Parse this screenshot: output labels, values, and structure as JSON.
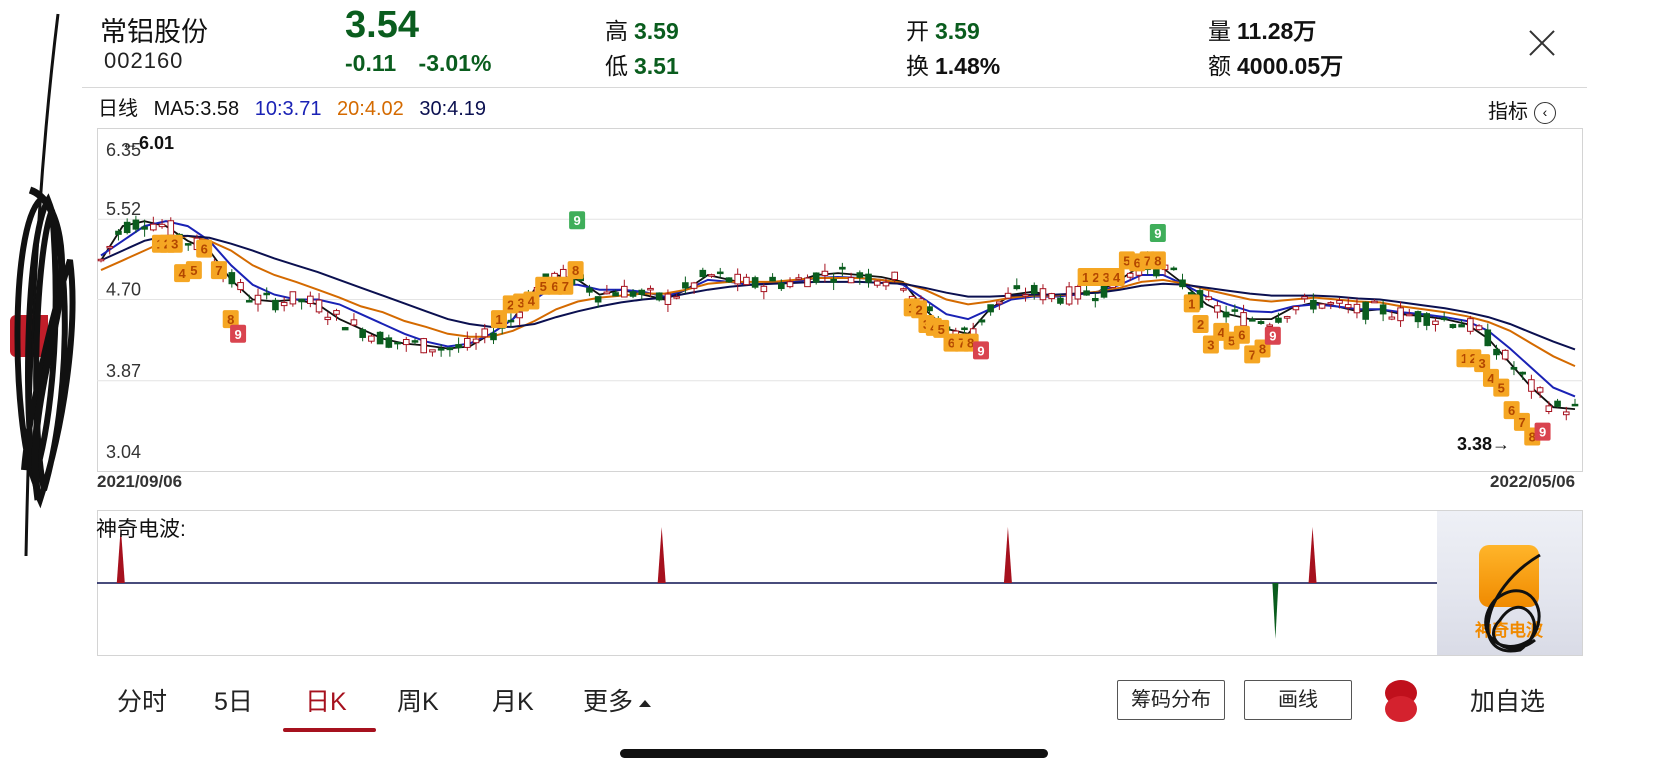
{
  "header": {
    "stock_name": "常铝股份",
    "stock_code": "002160",
    "price": "3.54",
    "change": "-0.11",
    "change_pct": "-3.01%",
    "high_label": "高",
    "high_value": "3.59",
    "low_label": "低",
    "low_value": "3.51",
    "open_label": "开",
    "open_value": "3.59",
    "turnover_label": "换",
    "turnover_value": "1.48%",
    "volume_label": "量",
    "volume_value": "11.28万",
    "amount_label": "额",
    "amount_value": "4000.05万"
  },
  "ma_legend": {
    "period": "日线",
    "ma5": "MA5:3.58",
    "ma10": "10:3.71",
    "ma20": "20:4.02",
    "ma30": "30:4.19"
  },
  "indicator_button": "指标",
  "colors": {
    "up": "#a6111e",
    "down": "#0a5d1e",
    "ma5": "#111111",
    "ma10": "#1a22b5",
    "ma20": "#d46a00",
    "ma30": "#0b1050",
    "signal_orange": "#f5a623",
    "signal_red": "#d9444f",
    "signal_green": "#3fae5a"
  },
  "chart_data": {
    "type": "candlestick",
    "y_ticks": [
      "6.35",
      "5.52",
      "4.70",
      "3.87",
      "3.04"
    ],
    "ylim": [
      3.04,
      6.35
    ],
    "x_start_label": "2021/09/06",
    "x_end_label": "2022/05/06",
    "max_marker": "←6.01",
    "min_marker": "3.38→",
    "series": [
      {
        "name": "MA5",
        "values": [
          5.1,
          5.45,
          5.5,
          5.45,
          5.3,
          5.2,
          4.9,
          4.7,
          4.68,
          4.7,
          4.65,
          4.5,
          4.4,
          4.3,
          4.25,
          4.23,
          4.2,
          4.22,
          4.35,
          4.5,
          4.8,
          4.95,
          4.9,
          4.75,
          4.8,
          4.75,
          4.7,
          4.8,
          4.95,
          4.9,
          4.85,
          4.87,
          4.88,
          4.95,
          4.97,
          4.95,
          4.93,
          4.88,
          4.6,
          4.4,
          4.35,
          4.6,
          4.75,
          4.78,
          4.73,
          4.75,
          4.78,
          4.9,
          5.05,
          5.02,
          4.85,
          4.65,
          4.55,
          4.5,
          4.5,
          4.62,
          4.67,
          4.63,
          4.58,
          4.6,
          4.55,
          4.53,
          4.5,
          4.45,
          4.3,
          4.05,
          3.8,
          3.6,
          3.58
        ]
      },
      {
        "name": "MA10",
        "values": [
          5.15,
          5.3,
          5.45,
          5.5,
          5.45,
          5.3,
          5.05,
          4.85,
          4.75,
          4.7,
          4.7,
          4.65,
          4.55,
          4.45,
          4.35,
          4.27,
          4.22,
          4.25,
          4.35,
          4.5,
          4.7,
          4.85,
          4.85,
          4.8,
          4.8,
          4.78,
          4.73,
          4.8,
          4.9,
          4.88,
          4.85,
          4.87,
          4.88,
          4.92,
          4.93,
          4.92,
          4.9,
          4.85,
          4.7,
          4.55,
          4.5,
          4.6,
          4.7,
          4.73,
          4.73,
          4.75,
          4.78,
          4.85,
          4.95,
          4.95,
          4.85,
          4.73,
          4.65,
          4.58,
          4.57,
          4.63,
          4.65,
          4.63,
          4.6,
          4.6,
          4.57,
          4.55,
          4.52,
          4.48,
          4.38,
          4.2,
          4.0,
          3.8,
          3.71
        ]
      },
      {
        "name": "MA20",
        "values": [
          5.0,
          5.1,
          5.2,
          5.3,
          5.35,
          5.3,
          5.2,
          5.05,
          4.95,
          4.88,
          4.8,
          4.72,
          4.63,
          4.57,
          4.48,
          4.42,
          4.35,
          4.32,
          4.32,
          4.38,
          4.48,
          4.6,
          4.68,
          4.72,
          4.74,
          4.76,
          4.76,
          4.8,
          4.86,
          4.88,
          4.88,
          4.88,
          4.9,
          4.92,
          4.92,
          4.92,
          4.9,
          4.87,
          4.8,
          4.7,
          4.65,
          4.68,
          4.72,
          4.74,
          4.74,
          4.76,
          4.78,
          4.82,
          4.88,
          4.9,
          4.86,
          4.8,
          4.75,
          4.7,
          4.68,
          4.7,
          4.72,
          4.7,
          4.68,
          4.67,
          4.63,
          4.6,
          4.57,
          4.53,
          4.47,
          4.38,
          4.25,
          4.12,
          4.02
        ]
      },
      {
        "name": "MA30",
        "values": [
          5.1,
          5.2,
          5.3,
          5.35,
          5.35,
          5.33,
          5.27,
          5.2,
          5.12,
          5.05,
          4.98,
          4.9,
          4.82,
          4.74,
          4.66,
          4.58,
          4.5,
          4.45,
          4.42,
          4.42,
          4.45,
          4.52,
          4.58,
          4.63,
          4.67,
          4.7,
          4.72,
          4.76,
          4.8,
          4.83,
          4.85,
          4.86,
          4.87,
          4.88,
          4.88,
          4.88,
          4.87,
          4.86,
          4.82,
          4.77,
          4.73,
          4.73,
          4.74,
          4.75,
          4.75,
          4.76,
          4.77,
          4.8,
          4.84,
          4.86,
          4.85,
          4.82,
          4.79,
          4.76,
          4.74,
          4.74,
          4.74,
          4.73,
          4.71,
          4.7,
          4.67,
          4.64,
          4.61,
          4.57,
          4.52,
          4.45,
          4.36,
          4.27,
          4.19
        ]
      }
    ],
    "signals": [
      {
        "x": 0.04,
        "price": 5.27,
        "label": "1",
        "kind": "orange"
      },
      {
        "x": 0.045,
        "price": 5.27,
        "label": "2",
        "kind": "orange"
      },
      {
        "x": 0.05,
        "price": 5.27,
        "label": "3",
        "kind": "orange"
      },
      {
        "x": 0.055,
        "price": 4.97,
        "label": "4",
        "kind": "orange"
      },
      {
        "x": 0.063,
        "price": 5.0,
        "label": "5",
        "kind": "orange"
      },
      {
        "x": 0.07,
        "price": 5.22,
        "label": "6",
        "kind": "orange"
      },
      {
        "x": 0.08,
        "price": 5.0,
        "label": "7",
        "kind": "orange"
      },
      {
        "x": 0.088,
        "price": 4.5,
        "label": "8",
        "kind": "orange"
      },
      {
        "x": 0.093,
        "price": 4.35,
        "label": "9",
        "kind": "red"
      },
      {
        "x": 0.27,
        "price": 4.5,
        "label": "1",
        "kind": "orange"
      },
      {
        "x": 0.278,
        "price": 4.65,
        "label": "2",
        "kind": "orange"
      },
      {
        "x": 0.285,
        "price": 4.67,
        "label": "3",
        "kind": "orange"
      },
      {
        "x": 0.292,
        "price": 4.69,
        "label": "4",
        "kind": "orange"
      },
      {
        "x": 0.3,
        "price": 4.84,
        "label": "5",
        "kind": "orange"
      },
      {
        "x": 0.308,
        "price": 4.84,
        "label": "6",
        "kind": "orange"
      },
      {
        "x": 0.315,
        "price": 4.84,
        "label": "7",
        "kind": "orange"
      },
      {
        "x": 0.322,
        "price": 5.0,
        "label": "8",
        "kind": "orange"
      },
      {
        "x": 0.323,
        "price": 5.51,
        "label": "9",
        "kind": "green"
      },
      {
        "x": 0.55,
        "price": 4.62,
        "label": "1",
        "kind": "orange"
      },
      {
        "x": 0.555,
        "price": 4.6,
        "label": "2",
        "kind": "orange"
      },
      {
        "x": 0.56,
        "price": 4.45,
        "label": "3",
        "kind": "orange"
      },
      {
        "x": 0.565,
        "price": 4.42,
        "label": "4",
        "kind": "orange"
      },
      {
        "x": 0.57,
        "price": 4.4,
        "label": "5",
        "kind": "orange"
      },
      {
        "x": 0.577,
        "price": 4.26,
        "label": "6",
        "kind": "orange"
      },
      {
        "x": 0.584,
        "price": 4.26,
        "label": "7",
        "kind": "orange"
      },
      {
        "x": 0.59,
        "price": 4.26,
        "label": "8",
        "kind": "orange"
      },
      {
        "x": 0.597,
        "price": 4.18,
        "label": "9",
        "kind": "red"
      },
      {
        "x": 0.668,
        "price": 4.93,
        "label": "1",
        "kind": "orange"
      },
      {
        "x": 0.675,
        "price": 4.93,
        "label": "2",
        "kind": "orange"
      },
      {
        "x": 0.682,
        "price": 4.93,
        "label": "3",
        "kind": "orange"
      },
      {
        "x": 0.689,
        "price": 4.93,
        "label": "4",
        "kind": "orange"
      },
      {
        "x": 0.696,
        "price": 5.1,
        "label": "5",
        "kind": "orange"
      },
      {
        "x": 0.703,
        "price": 5.08,
        "label": "6",
        "kind": "orange"
      },
      {
        "x": 0.71,
        "price": 5.1,
        "label": "7",
        "kind": "orange"
      },
      {
        "x": 0.717,
        "price": 5.1,
        "label": "8",
        "kind": "orange"
      },
      {
        "x": 0.717,
        "price": 5.38,
        "label": "9",
        "kind": "green"
      },
      {
        "x": 0.74,
        "price": 4.66,
        "label": "1",
        "kind": "orange"
      },
      {
        "x": 0.746,
        "price": 4.45,
        "label": "2",
        "kind": "orange"
      },
      {
        "x": 0.753,
        "price": 4.24,
        "label": "3",
        "kind": "orange"
      },
      {
        "x": 0.76,
        "price": 4.37,
        "label": "4",
        "kind": "orange"
      },
      {
        "x": 0.767,
        "price": 4.28,
        "label": "5",
        "kind": "orange"
      },
      {
        "x": 0.774,
        "price": 4.34,
        "label": "6",
        "kind": "orange"
      },
      {
        "x": 0.781,
        "price": 4.14,
        "label": "7",
        "kind": "orange"
      },
      {
        "x": 0.788,
        "price": 4.2,
        "label": "8",
        "kind": "orange"
      },
      {
        "x": 0.795,
        "price": 4.33,
        "label": "9",
        "kind": "red"
      },
      {
        "x": 0.925,
        "price": 4.1,
        "label": "1",
        "kind": "orange"
      },
      {
        "x": 0.931,
        "price": 4.1,
        "label": "2",
        "kind": "orange"
      },
      {
        "x": 0.937,
        "price": 4.05,
        "label": "3",
        "kind": "orange"
      },
      {
        "x": 0.943,
        "price": 3.9,
        "label": "4",
        "kind": "orange"
      },
      {
        "x": 0.95,
        "price": 3.8,
        "label": "5",
        "kind": "orange"
      },
      {
        "x": 0.957,
        "price": 3.57,
        "label": "6",
        "kind": "orange"
      },
      {
        "x": 0.964,
        "price": 3.45,
        "label": "7",
        "kind": "orange"
      },
      {
        "x": 0.971,
        "price": 3.3,
        "label": "8",
        "kind": "orange"
      },
      {
        "x": 0.978,
        "price": 3.35,
        "label": "9",
        "kind": "red"
      }
    ]
  },
  "oscillator": {
    "title": "神奇电波:",
    "spikes": [
      {
        "x": 0.016,
        "dir": "up"
      },
      {
        "x": 0.38,
        "dir": "up"
      },
      {
        "x": 0.613,
        "dir": "up"
      },
      {
        "x": 0.793,
        "dir": "down"
      },
      {
        "x": 0.818,
        "dir": "up"
      }
    ],
    "thumb_text": "神奇电波"
  },
  "tabs": [
    {
      "label": "分时",
      "active": false
    },
    {
      "label": "5日",
      "active": false
    },
    {
      "label": "日K",
      "active": true
    },
    {
      "label": "周K",
      "active": false
    },
    {
      "label": "月K",
      "active": false
    },
    {
      "label": "更多",
      "active": false
    }
  ],
  "buttons": {
    "chip_distribution": "筹码分布",
    "draw_line": "画线",
    "add_watchlist": "加自选"
  }
}
